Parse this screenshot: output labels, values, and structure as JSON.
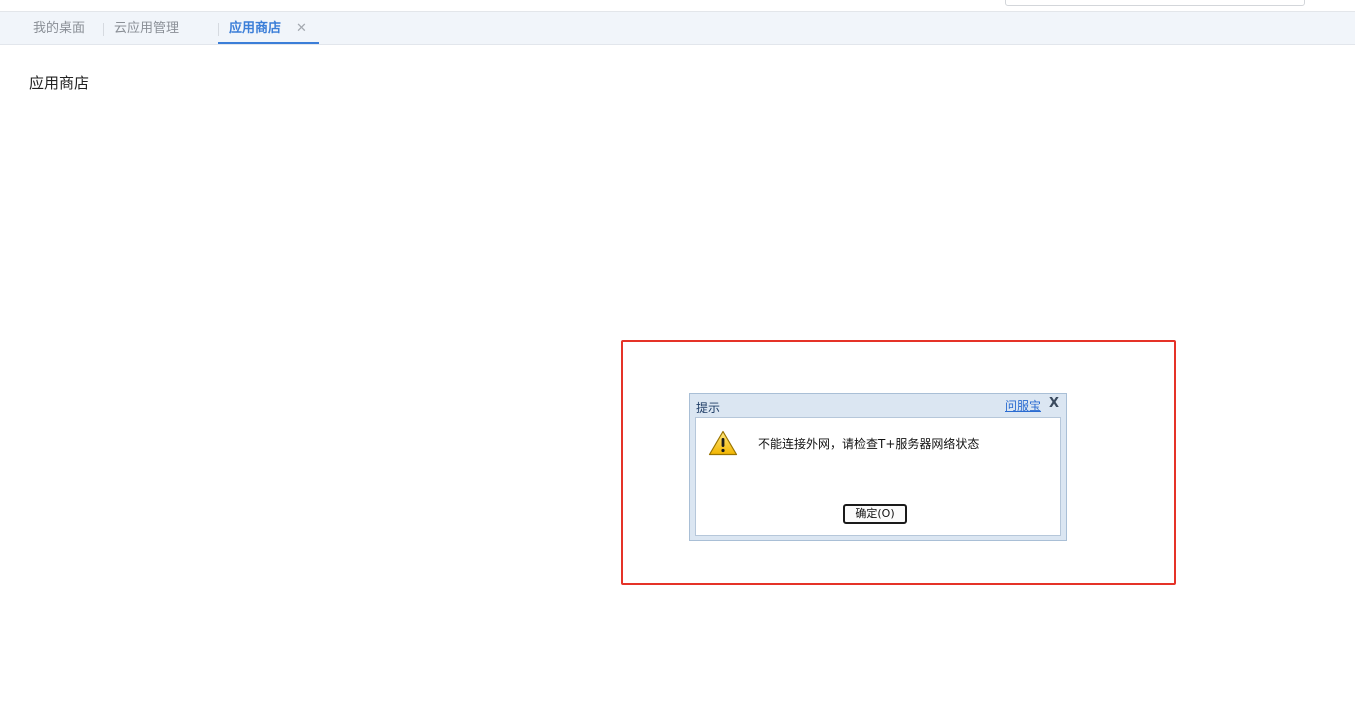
{
  "tabs": {
    "items": [
      {
        "label": "我的桌面"
      },
      {
        "label": "云应用管理"
      },
      {
        "label": "应用商店",
        "active": true,
        "close_icon": "✕"
      }
    ]
  },
  "page": {
    "title": "应用商店"
  },
  "dialog": {
    "title": "提示",
    "help_link": "问服宝",
    "close_icon": "X",
    "icon": "warning-icon",
    "message": "不能连接外网，请检查T+服务器网络状态",
    "ok_label": "确定(O)"
  },
  "colors": {
    "accent": "#3b7ed8",
    "highlight_frame": "#e53228",
    "dialog_frame": "#dbe6f2"
  }
}
